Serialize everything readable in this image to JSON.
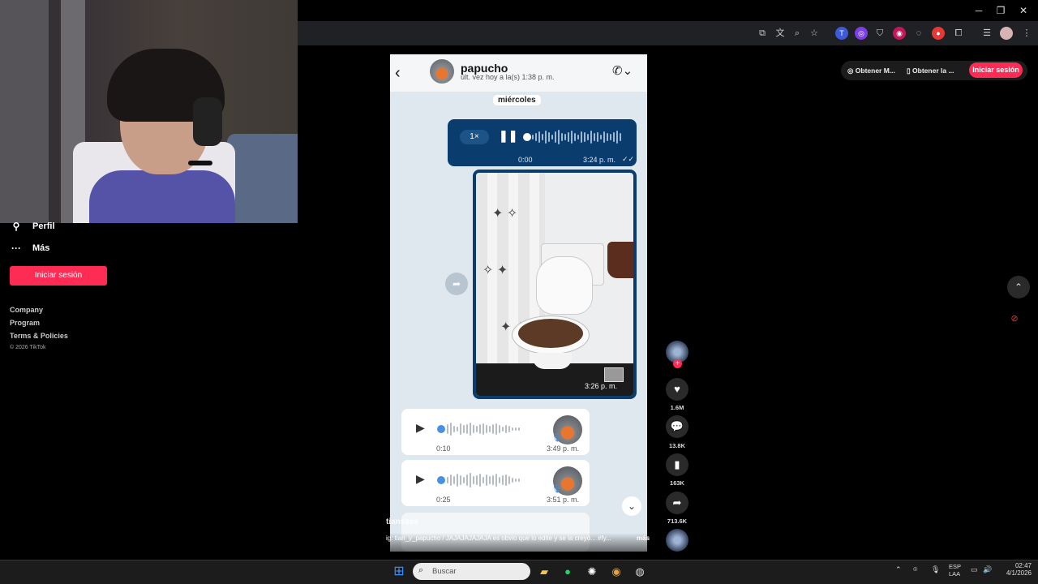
{
  "sidebar": {
    "items": [
      {
        "label": "Perfil",
        "icon": "person-icon"
      },
      {
        "label": "Más",
        "icon": "more-icon"
      }
    ],
    "login_label": "Iniciar sesión",
    "footer_links": [
      "Company",
      "Program",
      "Terms & Policies"
    ],
    "copyright": "© 2026 TikTok"
  },
  "top_right": {
    "pill1": "Obtener M...",
    "pill2": "Obtener la ...",
    "login_label": "Iniciar sesión"
  },
  "chat": {
    "contact_name": "papucho",
    "status": "últ. vez hoy a la(s) 1:38 p. m.",
    "day_label": "miércoles",
    "outgoing_voice": {
      "speed": "1×",
      "elapsed": "0:00",
      "time": "3:24 p. m."
    },
    "photo": {
      "time": "3:26 p. m."
    },
    "incoming_voice": [
      {
        "duration": "0:10",
        "time": "3:49 p. m."
      },
      {
        "duration": "0:25",
        "time": "3:51 p. m."
      }
    ]
  },
  "caption": {
    "username": "tianssss",
    "text": "ig: tian_y_papucho / JAJAJAJAJAJA es obvio que lo edite y se la creyó... #fy...",
    "more": "más"
  },
  "actions": {
    "likes": "1.6M",
    "comments": "13.8K",
    "saves": "163K",
    "shares": "713.6K"
  },
  "taskbar": {
    "search_placeholder": "Buscar",
    "lang_top": "ESP",
    "lang_bottom": "LAA",
    "time": "02:47",
    "date": "4/1/2026"
  }
}
